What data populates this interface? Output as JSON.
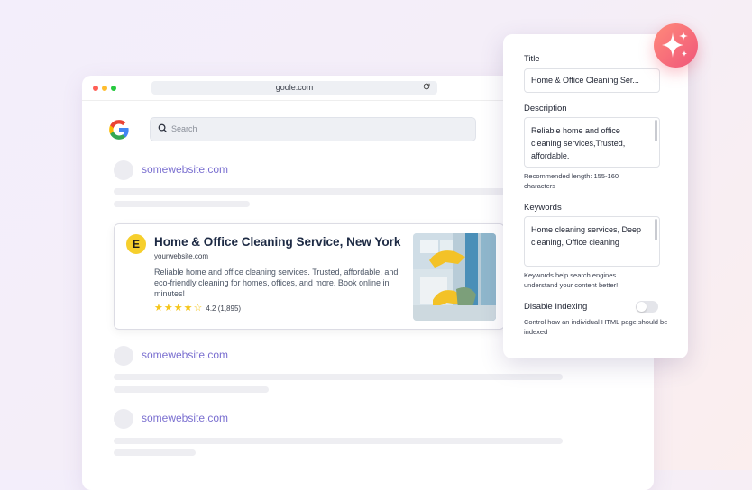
{
  "browser": {
    "url": "goole.com",
    "search_placeholder": "Search"
  },
  "results": [
    {
      "site": "somewebsite.com"
    },
    {
      "site": "somewebsite.com"
    },
    {
      "site": "somewebsite.com"
    }
  ],
  "featured": {
    "badge": "E",
    "title": "Home & Office Cleaning Service, New York",
    "url": "yourwebsite.com",
    "description": "Reliable home and office cleaning services. Trusted, affordable, and eco-friendly cleaning for homes, offices, and more. Book online in minutes!",
    "rating": 4.2,
    "rating_text": "4.2 (1,895)",
    "review_count": "1,895"
  },
  "seo_panel": {
    "title_label": "Title",
    "title_value": "Home & Office Cleaning Ser...",
    "description_label": "Description",
    "description_value": "Reliable home and office cleaning services,Trusted, affordable.",
    "description_help": "Recommended length: 155-160 characters",
    "keywords_label": "Keywords",
    "keywords_value": "Home cleaning services, Deep cleaning, Office cleaning",
    "keywords_help": "Keywords help search engines understand your content better!",
    "indexing_label": "Disable Indexing",
    "indexing_enabled": false,
    "indexing_help": "Control how an individual HTML page should be indexed"
  },
  "colors": {
    "link": "#7a6fd0",
    "badge": "#f6cf2c",
    "star": "#f5c518",
    "sparkle_gradient": [
      "#ff8a7a",
      "#f0567a"
    ]
  },
  "icons": [
    "google-logo",
    "search-icon",
    "reload-icon",
    "star-icon",
    "sparkle-icon"
  ]
}
